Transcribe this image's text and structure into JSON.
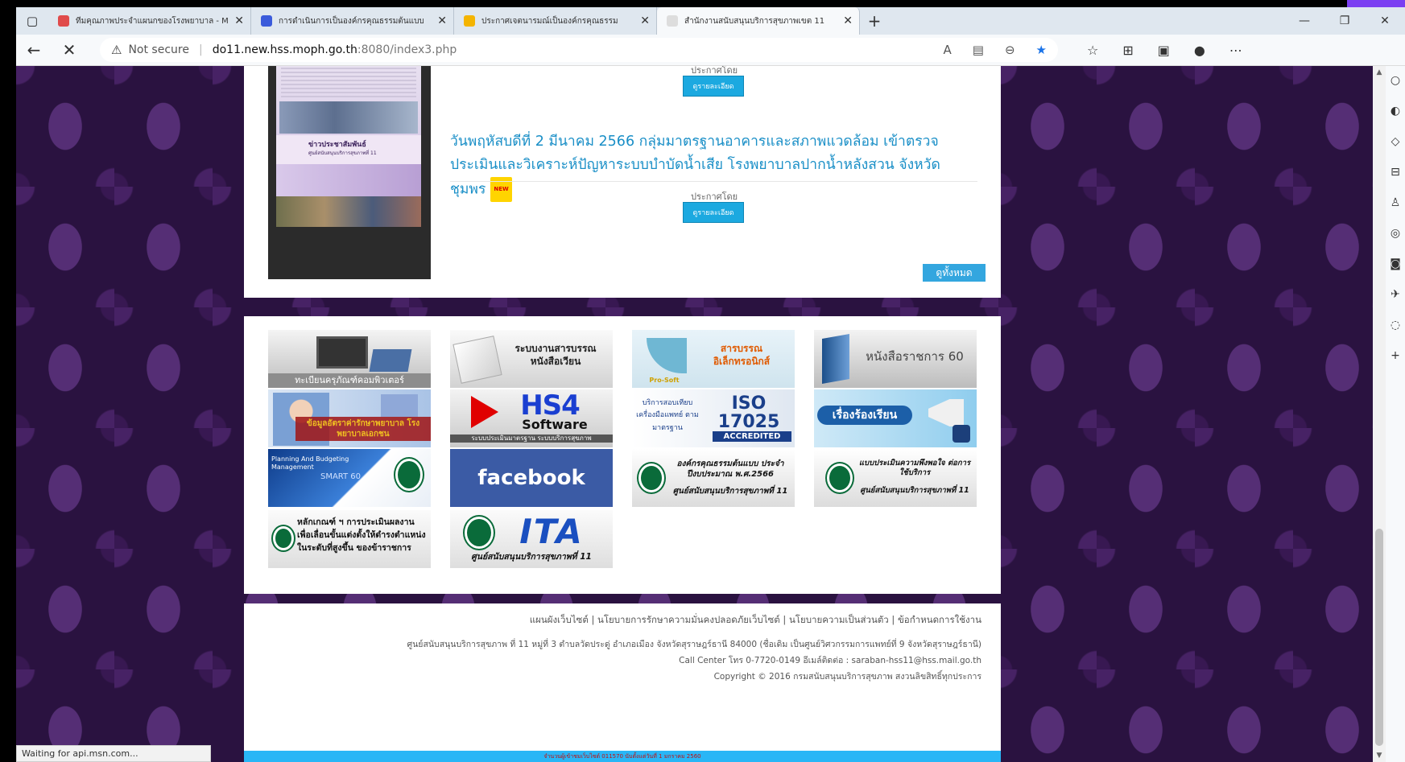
{
  "browser": {
    "tabs": [
      {
        "title": "ทีมคุณภาพประจำแผนกของโรงพยาบาล - M",
        "favicon_color": "#e04b4b",
        "active": false
      },
      {
        "title": "การดำเนินการเป็นองค์กรคุณธรรมต้นแบบ",
        "favicon_color": "#3b5bdb",
        "active": false
      },
      {
        "title": "ประกาศเจตนารมณ์เป็นองค์กรคุณธรรม",
        "favicon_color": "#f4b400",
        "active": false
      },
      {
        "title": "สำนักงานสนับสนุนบริการสุขภาพเขต 11",
        "favicon_color": "#dddddd",
        "active": true
      }
    ],
    "address": {
      "security_label": "Not secure",
      "host": "do11.new.hss.moph.go.th",
      "path": ":8080/index3.php"
    },
    "status_text": "Waiting for api.msn.com..."
  },
  "news": {
    "thumbnail": {
      "banner_title": "ข่าวประชาสัมพันธ์",
      "banner_sub": "ศูนย์สนับสนุนบริการสุขภาพที่ 11"
    },
    "items": [
      {
        "posted_by": "ประกาศโดย",
        "detail_label": "ดูรายละเอียด"
      },
      {
        "headline": "วันพฤหัสบดีที่ 2 มีนาคม 2566 กลุ่มมาตรฐานอาคารและสภาพแวดล้อม เข้าตรวจประเมินและวิเคราะห์ปัญหาระบบบำบัดน้ำเสีย โรงพยาบาลปากน้ำหลังสวน จังหวัดชุมพร",
        "badge": "NEW",
        "posted_by": "ประกาศโดย",
        "detail_label": "ดูรายละเอียด"
      }
    ],
    "view_all_label": "ดูทั้งหมด"
  },
  "links": [
    {
      "id": "computer",
      "label": "ทะเบียนครุภัณฑ์คอมพิวเตอร์",
      "bg": "#e4e4e4",
      "accent": "#888888"
    },
    {
      "id": "saraban-circular",
      "label": "ระบบงานสารบรรณ หนังสือเวียน",
      "bg": "#ececec",
      "accent": "#222222"
    },
    {
      "id": "e-saraban",
      "label": "สารบรรณ อิเล็กทรอนิกส์",
      "sublabel": "Pro-Soft",
      "bg": "#d8ecf5",
      "accent": "#e05a00"
    },
    {
      "id": "official-letter",
      "label": "หนังสือราชการ 60",
      "bg": "#e4e4e4",
      "accent": "#555555"
    },
    {
      "id": "private-hospital",
      "label": "ข้อมูลอัตราค่ารักษาพยาบาล โรงพยาบาลเอกชน",
      "bg": "#c9d9ee",
      "accent": "#f0c020"
    },
    {
      "id": "hs4",
      "label": "HS4",
      "sublabel": "Software",
      "caption": "ระบบประเมินมาตรฐาน ระบบบริการสุขภาพ",
      "bg": "#e6e6e6",
      "accent": "#1a3fd1"
    },
    {
      "id": "iso",
      "label": "ISO 17025",
      "sublabel": "ACCREDITED",
      "caption": "บริการสอบเทียบ เครื่องมือแพทย์ ตามมาตรฐาน",
      "bg": "#eef2f7",
      "accent": "#1a3f8a"
    },
    {
      "id": "complaint",
      "label": "เรื่องร้องเรียน",
      "bg": "#a9d8f0",
      "accent": "#1c5fa8"
    },
    {
      "id": "smart",
      "label": "Planning And Budgeting Management",
      "sublabel": "SMART 60",
      "bg": "#1f5fb8",
      "accent": "#ffffff"
    },
    {
      "id": "facebook",
      "label": "facebook",
      "bg": "#3b5ba5",
      "accent": "#ffffff"
    },
    {
      "id": "ethics",
      "label": "องค์กรคุณธรรมต้นแบบ ประจำปีงบประมาณ พ.ศ.2566",
      "caption": "ศูนย์สนับสนุนบริการสุขภาพที่ 11",
      "bg": "#eeeeee",
      "accent": "#0a6b3a"
    },
    {
      "id": "satisfaction",
      "label": "แบบประเมินความพึงพอใจ ต่อการใช้บริการ",
      "caption": "ศูนย์สนับสนุนบริการสุขภาพที่ 11",
      "bg": "#eeeeee",
      "accent": "#0a6b3a"
    },
    {
      "id": "criteria",
      "label": "หลักเกณฑ์ ฯ การประเมินผลงาน เพื่อเลื่อนขั้นแต่งตั้งให้ดำรงตำแหน่ง ในระดับที่สูงขึ้น ของข้าราชการ",
      "bg": "#eeeeee",
      "accent": "#0a6b3a"
    },
    {
      "id": "ita",
      "label": "ITA",
      "caption": "ศูนย์สนับสนุนบริการสุขภาพที่ 11",
      "bg": "#eeeeee",
      "accent": "#1a4fc0"
    }
  ],
  "footer": {
    "links_line": "แผนผังเว็บไซต์ | นโยบายการรักษาความมั่นคงปลอดภัยเว็บไซต์ | นโยบายความเป็นส่วนตัว | ข้อกำหนดการใช้งาน",
    "address": "ศูนย์สนับสนุนบริการสุขภาพ ที่ 11 หมู่ที่ 3 ตำบลวัดประดู่ อำเภอเมือง จังหวัดสุราษฎร์ธานี 84000 (ชื่อเดิม เป็นศูนย์วิศวกรรมการแพทย์ที่ 9 จังหวัดสุราษฎร์ธานี)",
    "contact": "Call Center โทร 0-7720-0149 อีเมล์ติดต่อ : saraban-hss11@hss.mail.go.th",
    "copyright": "Copyright © 2016 กรมสนับสนุนบริการสุขภาพ สงวนลิขสิทธิ์ทุกประการ",
    "counter": "จำนวนผู้เข้าชมเว็บไซต์ 011570 นับตั้งแต่วันที่ 1 มกราคม 2560"
  }
}
